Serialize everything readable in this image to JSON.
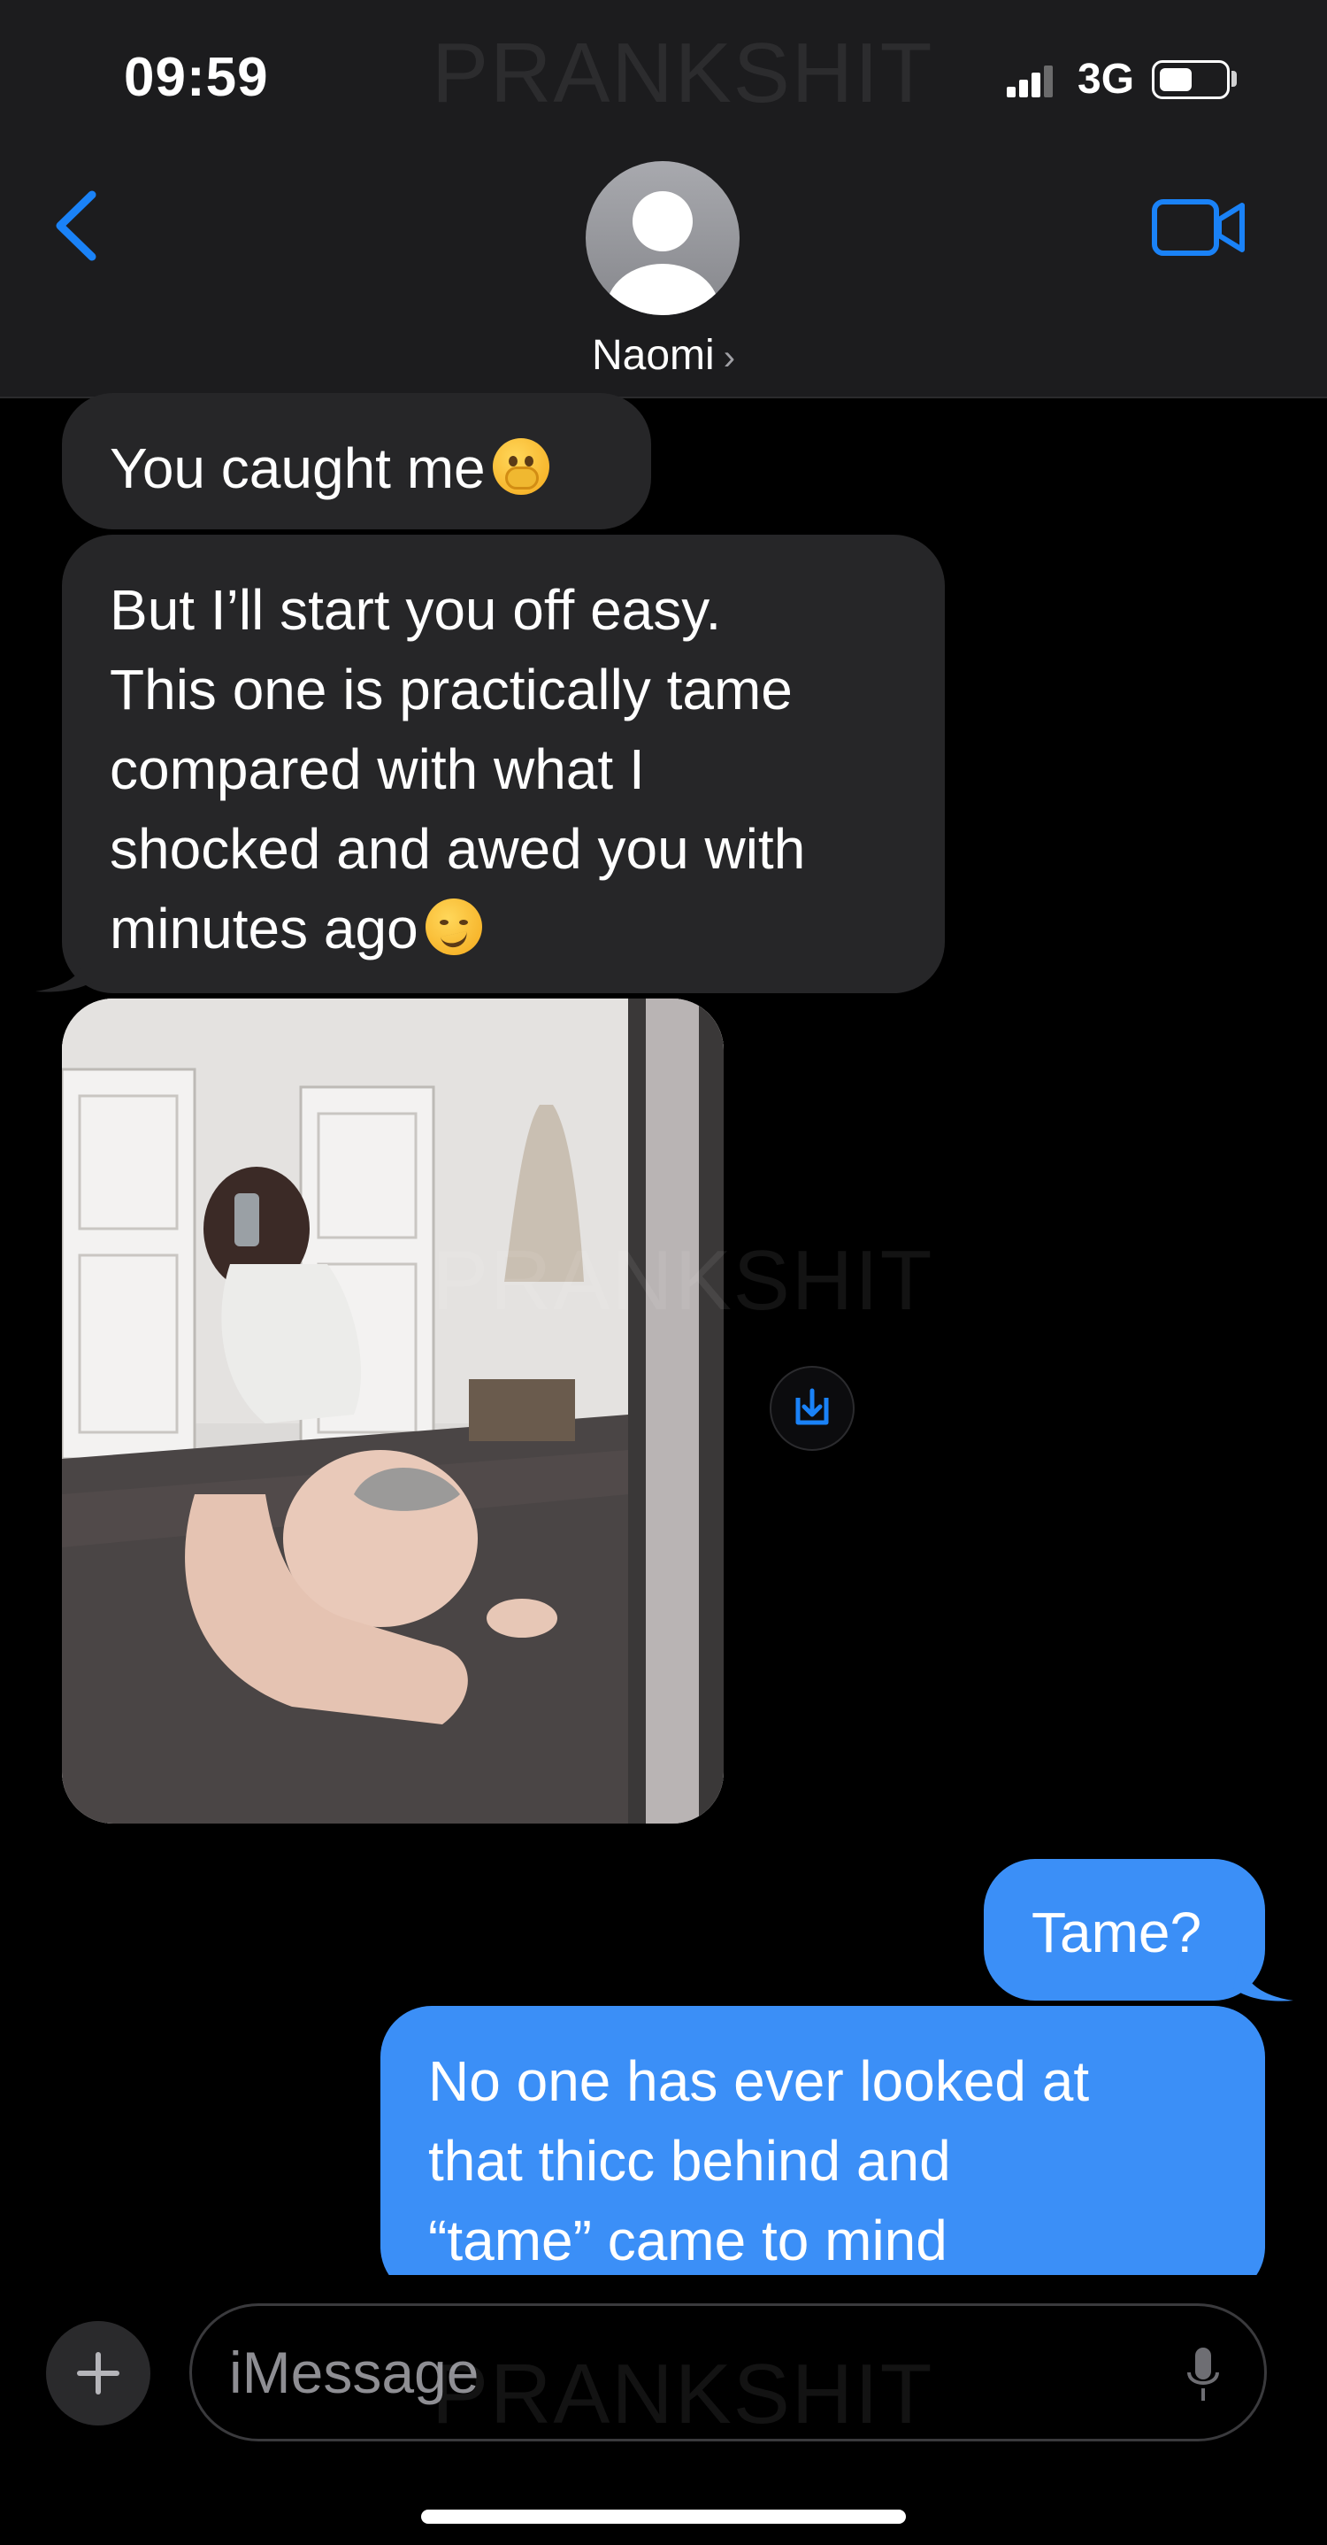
{
  "status_bar": {
    "time": "09:59",
    "network": "3G"
  },
  "header": {
    "contact_name": "Naomi",
    "chevron": "›"
  },
  "messages": [
    {
      "from": "contact",
      "lines": [
        "You caught me"
      ],
      "emoji": "hand-over-mouth-emoji"
    },
    {
      "from": "contact",
      "lines": [
        "But I’ll start you off easy.",
        "This one is practically tame",
        "compared with what I",
        "shocked and awed you with",
        "minutes ago"
      ],
      "emoji": "smirking-face-emoji"
    },
    {
      "from": "contact",
      "type": "photo"
    },
    {
      "from": "me",
      "lines": [
        "Tame?"
      ]
    },
    {
      "from": "me",
      "lines": [
        "No one has ever looked at",
        "that thicc behind and",
        "“tame” came to mind"
      ]
    }
  ],
  "composer": {
    "placeholder": "iMessage"
  },
  "watermark": "PRANKSHIT",
  "colors": {
    "header_bg": "#1c1c1e",
    "received_bubble": "#262628",
    "sent_bubble": "#3b8ff7",
    "accent": "#1a82f7"
  }
}
